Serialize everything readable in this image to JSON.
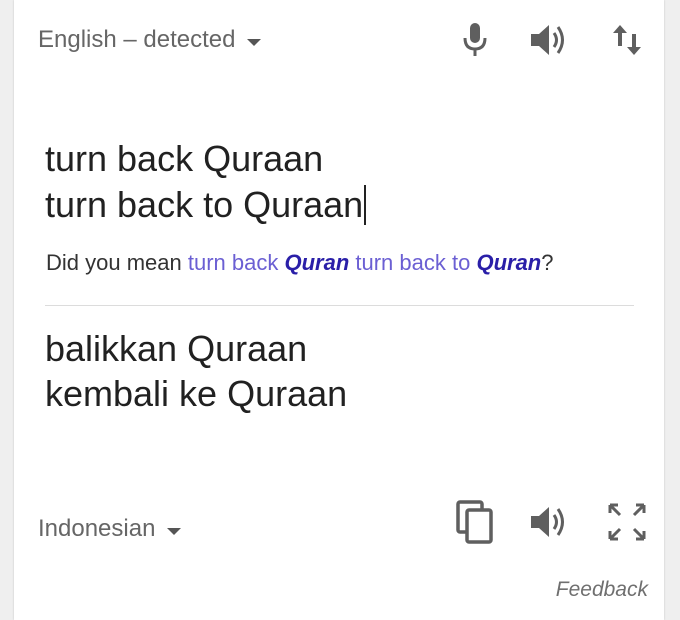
{
  "source": {
    "language_label": "English – detected",
    "text_lines": [
      "turn back Quraan",
      "turn back to Quraan"
    ]
  },
  "suggestion": {
    "prefix": "Did you mean ",
    "parts": [
      {
        "text": "turn back ",
        "bold": false
      },
      {
        "text": "Quran",
        "bold": true
      },
      {
        "text": " turn back to ",
        "bold": false
      },
      {
        "text": "Quran",
        "bold": true
      }
    ],
    "suffix": "?"
  },
  "target": {
    "language_label": "Indonesian",
    "text_lines": [
      "balikkan Quraan",
      "kembali ke Quraan"
    ]
  },
  "footer": {
    "feedback_label": "Feedback"
  },
  "icons": {
    "source_toolbar": [
      "microphone-icon",
      "speaker-icon",
      "swap-languages-icon"
    ],
    "target_toolbar": [
      "copy-icon",
      "speaker-icon",
      "fullscreen-icon"
    ]
  },
  "colors": {
    "suggestion_text": "#6b5fd3",
    "suggestion_bold": "#2a1fa8",
    "icon": "#5f5f5f"
  }
}
